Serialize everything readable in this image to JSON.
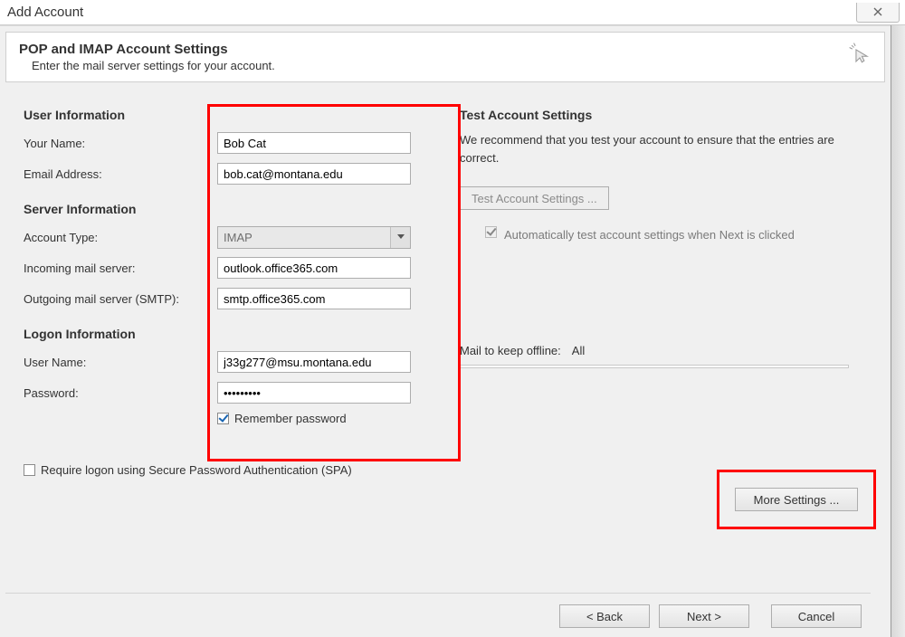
{
  "window": {
    "title": "Add Account",
    "close_label": "x"
  },
  "header": {
    "title": "POP and IMAP Account Settings",
    "subtitle": "Enter the mail server settings for your account."
  },
  "left": {
    "user_info_heading": "User Information",
    "your_name_label": "Your Name:",
    "your_name_value": "Bob Cat",
    "email_label": "Email Address:",
    "email_value": "bob.cat@montana.edu",
    "server_info_heading": "Server Information",
    "account_type_label": "Account Type:",
    "account_type_value": "IMAP",
    "incoming_label": "Incoming mail server:",
    "incoming_value": "outlook.office365.com",
    "outgoing_label": "Outgoing mail server (SMTP):",
    "outgoing_value": "smtp.office365.com",
    "logon_info_heading": "Logon Information",
    "user_name_label": "User Name:",
    "user_name_value": "j33g277@msu.montana.edu",
    "password_label": "Password:",
    "password_value": "•••••••••",
    "remember_label": "Remember password",
    "spa_label": "Require logon using Secure Password Authentication (SPA)"
  },
  "right": {
    "test_heading": "Test Account Settings",
    "test_desc": "We recommend that you test your account to ensure that the entries are correct.",
    "test_button": "Test Account Settings ...",
    "auto_test_label": "Automatically test account settings when Next is clicked",
    "mail_offline_label": "Mail to keep offline:",
    "mail_offline_value": "All",
    "more_settings_button": "More Settings ..."
  },
  "footer": {
    "back": "< Back",
    "next": "Next >",
    "cancel": "Cancel"
  }
}
